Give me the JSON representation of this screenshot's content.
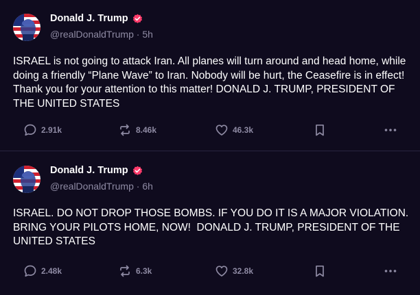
{
  "colors": {
    "background": "#0f0b1e",
    "divider": "#2a2540",
    "muted_text": "#8e8aa3",
    "verified_badge": "#ff3b6b"
  },
  "posts": [
    {
      "author": {
        "display_name": "Donald J. Trump",
        "handle": "@realDonaldTrump",
        "separator": "·",
        "time": "5h",
        "verified": true
      },
      "text": "ISRAEL is not going to attack Iran. All planes will turn around and head home, while doing a friendly “Plane Wave” to Iran. Nobody will be hurt, the Ceasefire is in effect! Thank you for your attention to this matter! DONALD J. TRUMP, PRESIDENT OF THE UNITED STATES",
      "actions": {
        "replies": "2.91k",
        "reposts": "8.46k",
        "likes": "46.3k",
        "bookmark_icon": "bookmark-icon",
        "more_icon": "more-icon"
      }
    },
    {
      "author": {
        "display_name": "Donald J. Trump",
        "handle": "@realDonaldTrump",
        "separator": "·",
        "time": "6h",
        "verified": true
      },
      "text": "ISRAEL. DO NOT DROP THOSE BOMBS. IF YOU DO IT IS A MAJOR VIOLATION. BRING YOUR PILOTS HOME, NOW!  DONALD J. TRUMP, PRESIDENT OF THE UNITED STATES",
      "actions": {
        "replies": "2.48k",
        "reposts": "6.3k",
        "likes": "32.8k",
        "bookmark_icon": "bookmark-icon",
        "more_icon": "more-icon"
      }
    }
  ]
}
